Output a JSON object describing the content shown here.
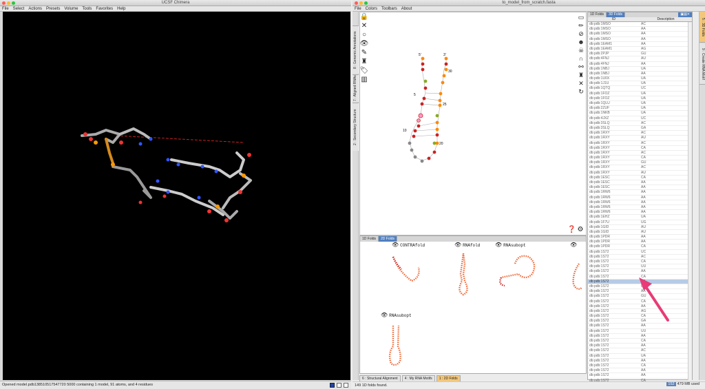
{
  "chimera": {
    "title": "UCSF Chimera",
    "menu": [
      "File",
      "Select",
      "Actions",
      "Presets",
      "Volume",
      "Tools",
      "Favorites",
      "Help"
    ],
    "status": "Opened model.pdb138510517547720 5000 containing 1 model, 91 atoms, and 4 residues"
  },
  "assemble": {
    "title": "to_model_from_scratch.fasta",
    "menu": [
      "File",
      "Colors",
      "Toolbars",
      "About"
    ],
    "left_tabs": [
      "8 : Genomic Annotations",
      "7 : Aligned RNAs",
      "2 : Secondary Structure"
    ],
    "right_tabs": [
      "5 : 3D Folds",
      "9 : Create RNA Motif"
    ],
    "structure_labels": {
      "five_prime": "5'",
      "three_prime": "3'",
      "n30": "30",
      "n25": "25",
      "n20": "20",
      "n10": "10",
      "n5": "5"
    },
    "folds_panel": {
      "tabs": [
        "1D Folds",
        "3D Folds"
      ],
      "headers": [
        "ID",
        "Description"
      ],
      "rows": [
        [
          "db:pdb:1MSO",
          "AC"
        ],
        [
          "db:pdb:1MSO",
          "AA"
        ],
        [
          "db:pdb:1MSO",
          "AA"
        ],
        [
          "db:pdb:1MSO",
          "AA"
        ],
        [
          "db:pdb:1EAM1",
          "AA"
        ],
        [
          "db:pdb:1EAM1",
          "AG"
        ],
        [
          "db:pdb:2PJP",
          "GU"
        ],
        [
          "db:pdb:4FNJ",
          "AU"
        ],
        [
          "db:pdb:4FNJ",
          "AA"
        ],
        [
          "db:pdb:1NBJ",
          "UA"
        ],
        [
          "db:pdb:1NBJ",
          "AA"
        ],
        [
          "db:pdb:1U0X",
          "UA"
        ],
        [
          "db:pdb:1J1U",
          "UA"
        ],
        [
          "db:pdb:1QTQ",
          "UC"
        ],
        [
          "db:pdb:1FOZ",
          "UA"
        ],
        [
          "db:pdb:1FOZ",
          "UA"
        ],
        [
          "db:pdb:1QLU",
          "UA"
        ],
        [
          "db:pdb:2ZUF",
          "UA"
        ],
        [
          "db:pdb:1NKB",
          "UA"
        ],
        [
          "db:pdb:4JXZ",
          "UC"
        ],
        [
          "db:pdb:3SLQ",
          "AC"
        ],
        [
          "db:pdb:3SLQ",
          "GA"
        ],
        [
          "db:pdb:1RXY",
          "AC"
        ],
        [
          "db:pdb:1RXY",
          "AU"
        ],
        [
          "db:pdb:1RXY",
          "AC"
        ],
        [
          "db:pdb:1RXY",
          "CA"
        ],
        [
          "db:pdb:1RXY",
          "AC"
        ],
        [
          "db:pdb:1RXY",
          "CA"
        ],
        [
          "db:pdb:1RXY",
          "GU"
        ],
        [
          "db:pdb:1RXY",
          "AC"
        ],
        [
          "db:pdb:1RXY",
          "AU"
        ],
        [
          "db:pdb:1ESC",
          "CA"
        ],
        [
          "db:pdb:1ESC",
          "AA"
        ],
        [
          "db:pdb:1ESC",
          "AA"
        ],
        [
          "db:pdb:1RW6",
          "AA"
        ],
        [
          "db:pdb:1RW6",
          "AA"
        ],
        [
          "db:pdb:1RW6",
          "AA"
        ],
        [
          "db:pdb:1RW6",
          "AA"
        ],
        [
          "db:pdb:1RW6",
          "AA"
        ],
        [
          "db:pdb:1EHZ",
          "UA"
        ],
        [
          "db:pdb:1F7U",
          "UG"
        ],
        [
          "db:pdb:1GID",
          "AU"
        ],
        [
          "db:pdb:1GID",
          "AU"
        ],
        [
          "db:pdb:1PDR",
          "AA"
        ],
        [
          "db:pdb:1PDR",
          "AA"
        ],
        [
          "db:pdb:1PDR",
          "CA"
        ],
        [
          "db:pdb:1S72",
          "UC"
        ],
        [
          "db:pdb:1S72",
          "AC"
        ],
        [
          "db:pdb:1S72",
          "CA"
        ],
        [
          "db:pdb:1S72",
          "UU"
        ],
        [
          "db:pdb:1S72",
          "AA"
        ],
        [
          "db:pdb:1S72",
          "CA"
        ],
        [
          "db:pdb:1S72",
          "AA"
        ],
        [
          "db:pdb:1S72",
          "UA"
        ],
        [
          "db:pdb:1S72",
          "AA"
        ],
        [
          "db:pdb:1S72",
          "GU"
        ],
        [
          "db:pdb:1S72",
          "CA"
        ],
        [
          "db:pdb:1S72",
          "AA"
        ],
        [
          "db:pdb:1S72",
          "AG"
        ],
        [
          "db:pdb:1S72",
          "CA"
        ],
        [
          "db:pdb:1S72",
          "GA"
        ],
        [
          "db:pdb:1S72",
          "AA"
        ],
        [
          "db:pdb:1S72",
          "UU"
        ],
        [
          "db:pdb:1S72",
          "AA"
        ],
        [
          "db:pdb:1S72",
          "CA"
        ],
        [
          "db:pdb:1S72",
          "AA"
        ],
        [
          "db:pdb:1S72",
          "AC"
        ],
        [
          "db:pdb:1S72",
          "UA"
        ],
        [
          "db:pdb:1S72",
          "AA"
        ],
        [
          "db:pdb:1S72",
          "CA"
        ],
        [
          "db:pdb:1S72",
          "AA"
        ],
        [
          "db:pdb:1S72",
          "AA"
        ],
        [
          "db:pdb:1S72",
          "CA"
        ]
      ],
      "selected_index": 52
    },
    "fold_panel": {
      "tabs": [
        "1D Folds",
        "2D Folds"
      ],
      "folds": [
        "CONTRAfold",
        "RNAfold",
        "RNAsubopt",
        "RNAsubopt"
      ]
    },
    "bottom_tabs": [
      "6 : Structural Alignment",
      "4 : My RNA Motifs",
      "1 : 2D Folds"
    ],
    "status": "149 1D folds found.",
    "memory": "479 MB used"
  },
  "colors": {
    "accent": "#4f7fc1",
    "active_tab": "#f2c77d",
    "arrow": "#e83b77"
  }
}
